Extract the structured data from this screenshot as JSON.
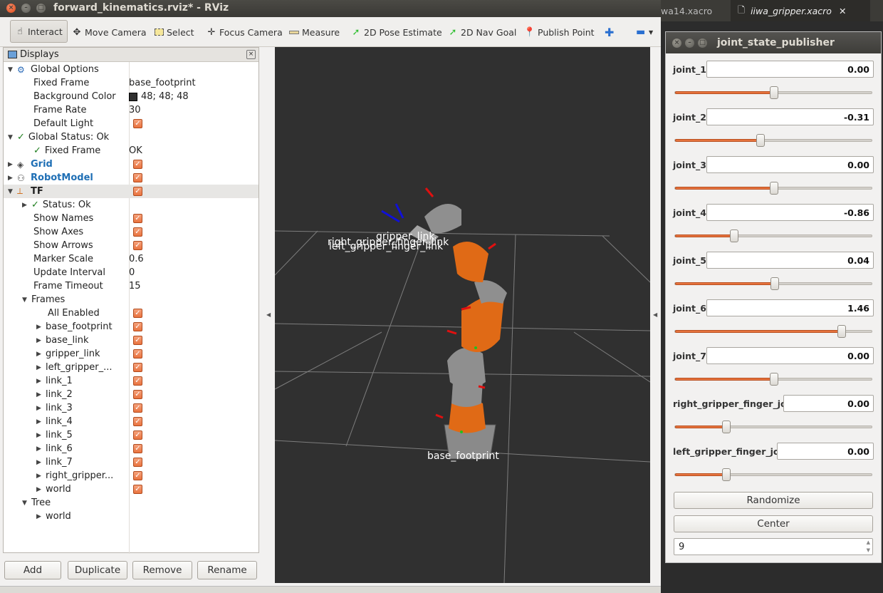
{
  "window": {
    "title": "forward_kinematics.rviz* - RViz"
  },
  "editor_tabs": [
    {
      "label": "wa14.xacro"
    },
    {
      "label": "iiwa_gripper.xacro",
      "close": "✕"
    }
  ],
  "toolbar": {
    "interact": "Interact",
    "move_camera": "Move Camera",
    "select": "Select",
    "focus_camera": "Focus Camera",
    "measure": "Measure",
    "pose_estimate": "2D Pose Estimate",
    "nav_goal": "2D Nav Goal",
    "publish_point": "Publish Point"
  },
  "displays": {
    "title": "Displays",
    "global_options": "Global Options",
    "fixed_frame_label": "Fixed Frame",
    "fixed_frame_value": "base_footprint",
    "bg_color_label": "Background Color",
    "bg_color_value": "48; 48; 48",
    "frame_rate_label": "Frame Rate",
    "frame_rate_value": "30",
    "default_light_label": "Default Light",
    "global_status": "Global Status: Ok",
    "status_fixed_frame": "Fixed Frame",
    "status_fixed_frame_value": "OK",
    "grid": "Grid",
    "robot_model": "RobotModel",
    "tf": "TF",
    "tf_status": "Status: Ok",
    "show_names": "Show Names",
    "show_axes": "Show Axes",
    "show_arrows": "Show Arrows",
    "marker_scale_label": "Marker Scale",
    "marker_scale_value": "0.6",
    "update_interval_label": "Update Interval",
    "update_interval_value": "0",
    "frame_timeout_label": "Frame Timeout",
    "frame_timeout_value": "15",
    "frames": "Frames",
    "all_enabled": "All Enabled",
    "frame_list": [
      "base_footprint",
      "base_link",
      "gripper_link",
      "left_gripper_...",
      "link_1",
      "link_2",
      "link_3",
      "link_4",
      "link_5",
      "link_6",
      "link_7",
      "right_gripper...",
      "world"
    ],
    "tree": "Tree",
    "tree_world": "world"
  },
  "panel_buttons": {
    "add": "Add",
    "duplicate": "Duplicate",
    "remove": "Remove",
    "rename": "Rename"
  },
  "viewport": {
    "labels": {
      "gripper": "gripper_link",
      "finger_right": "right_gripper_finger_link",
      "finger_left": "left_gripper_finger_link",
      "base": "base_footprint"
    }
  },
  "joint_state_publisher": {
    "title": "joint_state_publisher",
    "joints": [
      {
        "label": "joint_1",
        "value": "0.00",
        "frac": 0.5
      },
      {
        "label": "joint_2",
        "value": "-0.31",
        "frac": 0.43
      },
      {
        "label": "joint_3",
        "value": "0.00",
        "frac": 0.5
      },
      {
        "label": "joint_4",
        "value": "-0.86",
        "frac": 0.3
      },
      {
        "label": "joint_5",
        "value": "0.04",
        "frac": 0.505
      },
      {
        "label": "joint_6",
        "value": "1.46",
        "frac": 0.84
      },
      {
        "label": "joint_7",
        "value": "0.00",
        "frac": 0.5
      },
      {
        "label": "right_gripper_finger_joint",
        "value": "0.00",
        "frac": 0.26
      },
      {
        "label": "left_gripper_finger_joint",
        "value": "0.00",
        "frac": 0.26
      }
    ],
    "randomize": "Randomize",
    "center": "Center",
    "spin_value": "9"
  },
  "colors": {
    "accent": "#e6733e",
    "ok": "#1c7d1c",
    "link_blue": "#1f6fb5",
    "viewport_bg": "#303030"
  }
}
